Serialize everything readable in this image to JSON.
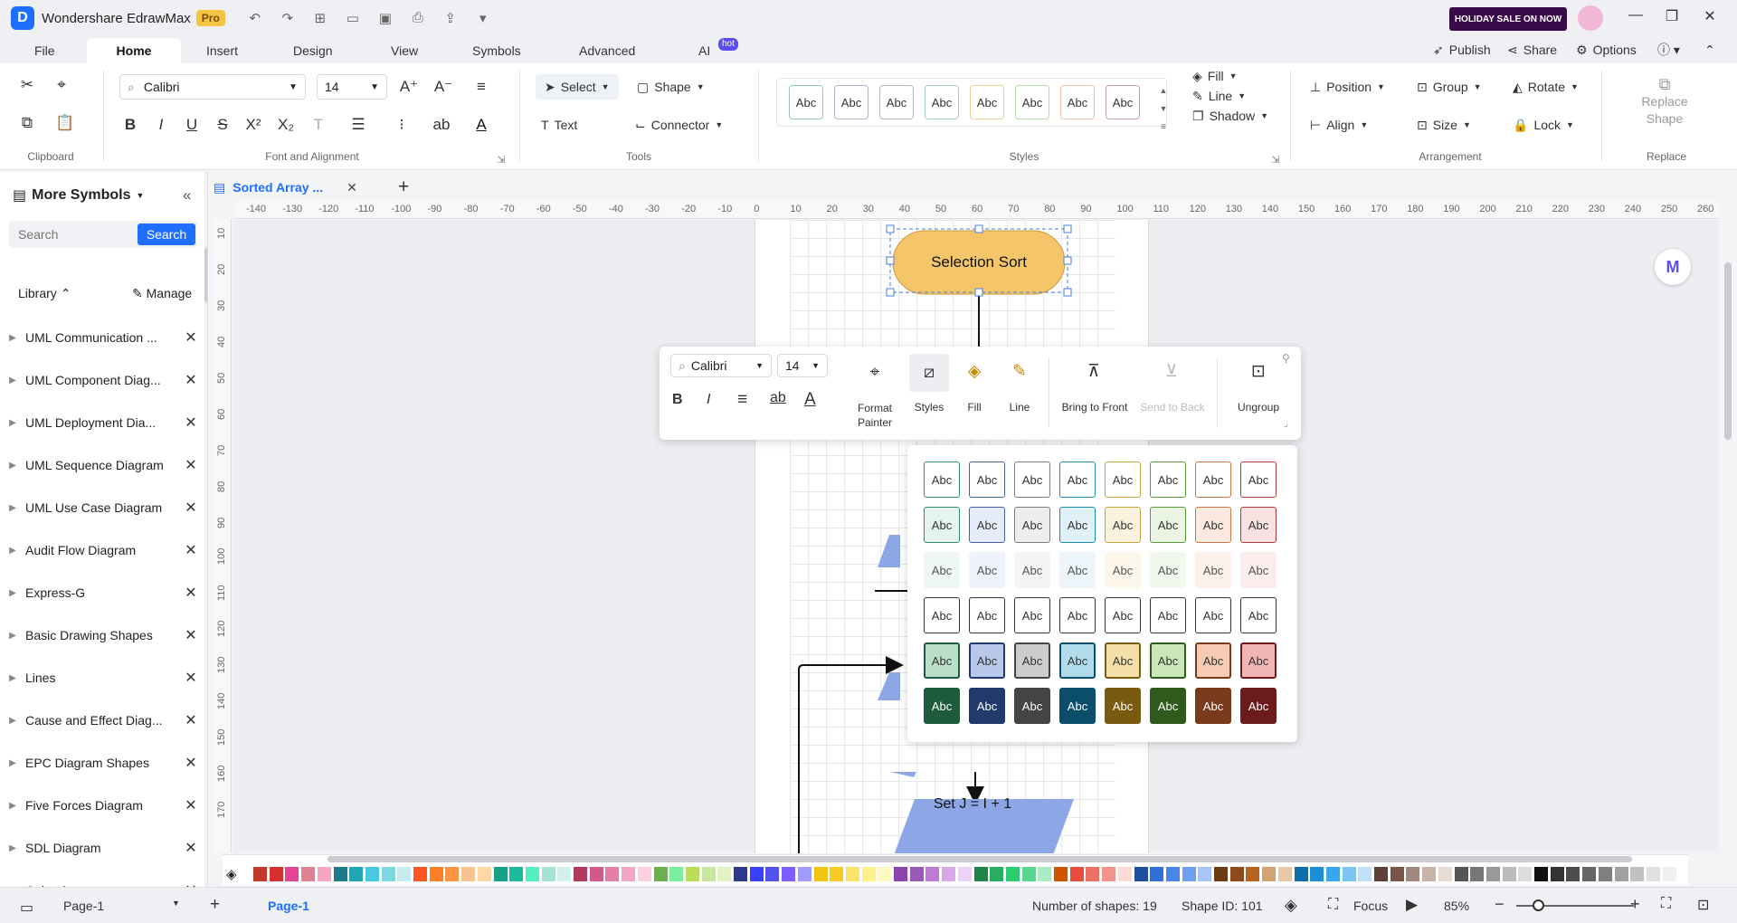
{
  "app": {
    "title": "Wondershare EdrawMax",
    "edition": "Pro",
    "promo": "HOLIDAY SALE ON NOW"
  },
  "menu_tabs": [
    {
      "label": "File"
    },
    {
      "label": "Home",
      "active": true
    },
    {
      "label": "Insert"
    },
    {
      "label": "Design"
    },
    {
      "label": "View"
    },
    {
      "label": "Symbols"
    },
    {
      "label": "Advanced"
    },
    {
      "label": "AI",
      "badge": "hot"
    }
  ],
  "header_actions": {
    "publish": "Publish",
    "share": "Share",
    "options": "Options"
  },
  "ribbon": {
    "font_name": "Calibri",
    "font_size": "14",
    "select": "Select",
    "shape": "Shape",
    "text": "Text",
    "connector": "Connector",
    "style_sample": "Abc",
    "fill": "Fill",
    "line": "Line",
    "shadow": "Shadow",
    "position": "Position",
    "group": "Group",
    "rotate": "Rotate",
    "align": "Align",
    "size": "Size",
    "lock": "Lock",
    "replace_shape": "Replace Shape",
    "groups": {
      "clipboard": "Clipboard",
      "font": "Font and Alignment",
      "tools": "Tools",
      "styles": "Styles",
      "arrangement": "Arrangement",
      "replace": "Replace"
    }
  },
  "sidebar": {
    "title": "More Symbols",
    "search_placeholder": "Search",
    "search_button": "Search",
    "library": "Library",
    "manage": "Manage",
    "items": [
      "UML Communication ...",
      "UML Component Diag...",
      "UML Deployment Dia...",
      "UML Sequence Diagram",
      "UML Use Case Diagram",
      "Audit Flow Diagram",
      "Express-G",
      "Basic Drawing Shapes",
      "Lines",
      "Cause and Effect Diag...",
      "EPC Diagram Shapes",
      "Five Forces Diagram",
      "SDL Diagram",
      "Calendar"
    ]
  },
  "document_tab": "Sorted Array ...",
  "ruler": {
    "h": [
      "-140",
      "-130",
      "-120",
      "-110",
      "-100",
      "-90",
      "-80",
      "-70",
      "-60",
      "-50",
      "-40",
      "-30",
      "-20",
      "-10",
      "0",
      "10",
      "20",
      "30",
      "40",
      "50",
      "60",
      "70",
      "80",
      "90",
      "100",
      "110",
      "120",
      "130",
      "140",
      "150",
      "160",
      "170",
      "180",
      "190",
      "200",
      "210",
      "220",
      "230",
      "240",
      "250",
      "260"
    ],
    "v": [
      "10",
      "20",
      "30",
      "40",
      "50",
      "60",
      "70",
      "80",
      "90",
      "100",
      "110",
      "120",
      "130",
      "140",
      "150",
      "160",
      "170"
    ]
  },
  "diagram": {
    "start_label": "Selection Sort",
    "step_label": "Set J = I + 1"
  },
  "floating_toolbar": {
    "font": "Calibri",
    "size": "14",
    "format_painter": "Format Painter",
    "styles": "Styles",
    "fill": "Fill",
    "line": "Line",
    "bring_front": "Bring to Front",
    "send_back": "Send to Back",
    "ungroup": "Ungroup"
  },
  "style_swatch_label": "Abc",
  "status": {
    "page_selector": "Page-1",
    "page_tab": "Page-1",
    "shape_count": "Number of shapes: 19",
    "shape_id": "Shape ID: 101",
    "focus": "Focus",
    "zoom": "85%"
  }
}
